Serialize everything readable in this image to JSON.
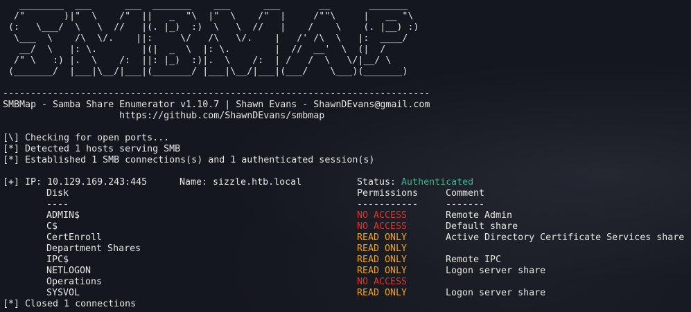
{
  "banner": {
    "ascii_art": "   ________  ___      ___  _______    ___      ___       __       _______\n  /\"       )|\"  \\    /\"  ||   _  \"\\  |\"  \\    /\"  |     /\"\"\\     |   __ \"\\\n (:   \\___/  \\   \\  //   |(. |_)  :)  \\   \\  //   |    /    \\    (. |__) :)\n  \\___  \\    /\\  \\/.    ||:     \\/   /\\   \\/.    |   /' /\\  \\   |:  ____/\n   __/  \\   |: \\.        |(|  _  \\  |: \\.        |  //  __'  \\  (|  /\n  /\" \\   :) |.  \\    /:  ||: |_)  :)|.  \\    /:  | /   /  \\   \\/|__/ \\\n (_______/  |___|\\__/|___|(_______/ |___|\\__/|___|(___/    \\___)(_______)",
    "separator": "-----------------------------------------------------------------------------"
  },
  "header": {
    "title_line": "SMBMap - Samba Share Enumerator v1.10.7 | Shawn Evans - ShawnDEvans@gmail.com",
    "url_line": "                     https://github.com/ShawnDEvans/smbmap"
  },
  "status_lines": [
    "[\\] Checking for open ports...",
    "[*] Detected 1 hosts serving SMB",
    "[*] Established 1 SMB connections(s) and 1 authenticated session(s)"
  ],
  "host": {
    "ip_label": "[+] IP: 10.129.169.243:445",
    "name_label": "Name: sizzle.htb.local",
    "status_label": "Status: ",
    "status_value": "Authenticated"
  },
  "columns": {
    "disk": "Disk",
    "disk_underline": "----",
    "permissions": "Permissions",
    "permissions_underline": "-----------",
    "comment": "Comment",
    "comment_underline": "-------"
  },
  "shares": [
    {
      "disk": "ADMIN$",
      "permissions": "NO ACCESS",
      "comment": "Remote Admin"
    },
    {
      "disk": "C$",
      "permissions": "NO ACCESS",
      "comment": "Default share"
    },
    {
      "disk": "CertEnroll",
      "permissions": "READ ONLY",
      "comment": "Active Directory Certificate Services share"
    },
    {
      "disk": "Department Shares",
      "permissions": "READ ONLY",
      "comment": ""
    },
    {
      "disk": "IPC$",
      "permissions": "READ ONLY",
      "comment": "Remote IPC"
    },
    {
      "disk": "NETLOGON",
      "permissions": "READ ONLY",
      "comment": "Logon server share"
    },
    {
      "disk": "Operations",
      "permissions": "NO ACCESS",
      "comment": ""
    },
    {
      "disk": "SYSVOL",
      "permissions": "READ ONLY",
      "comment": "Logon server share"
    }
  ],
  "footer": "[*] Closed 1 connections",
  "colors": {
    "background": "#15171e",
    "text": "#e6e6e6",
    "no_access": "#e0332e",
    "read_only": "#f0a020",
    "authenticated": "#3fb48f"
  }
}
